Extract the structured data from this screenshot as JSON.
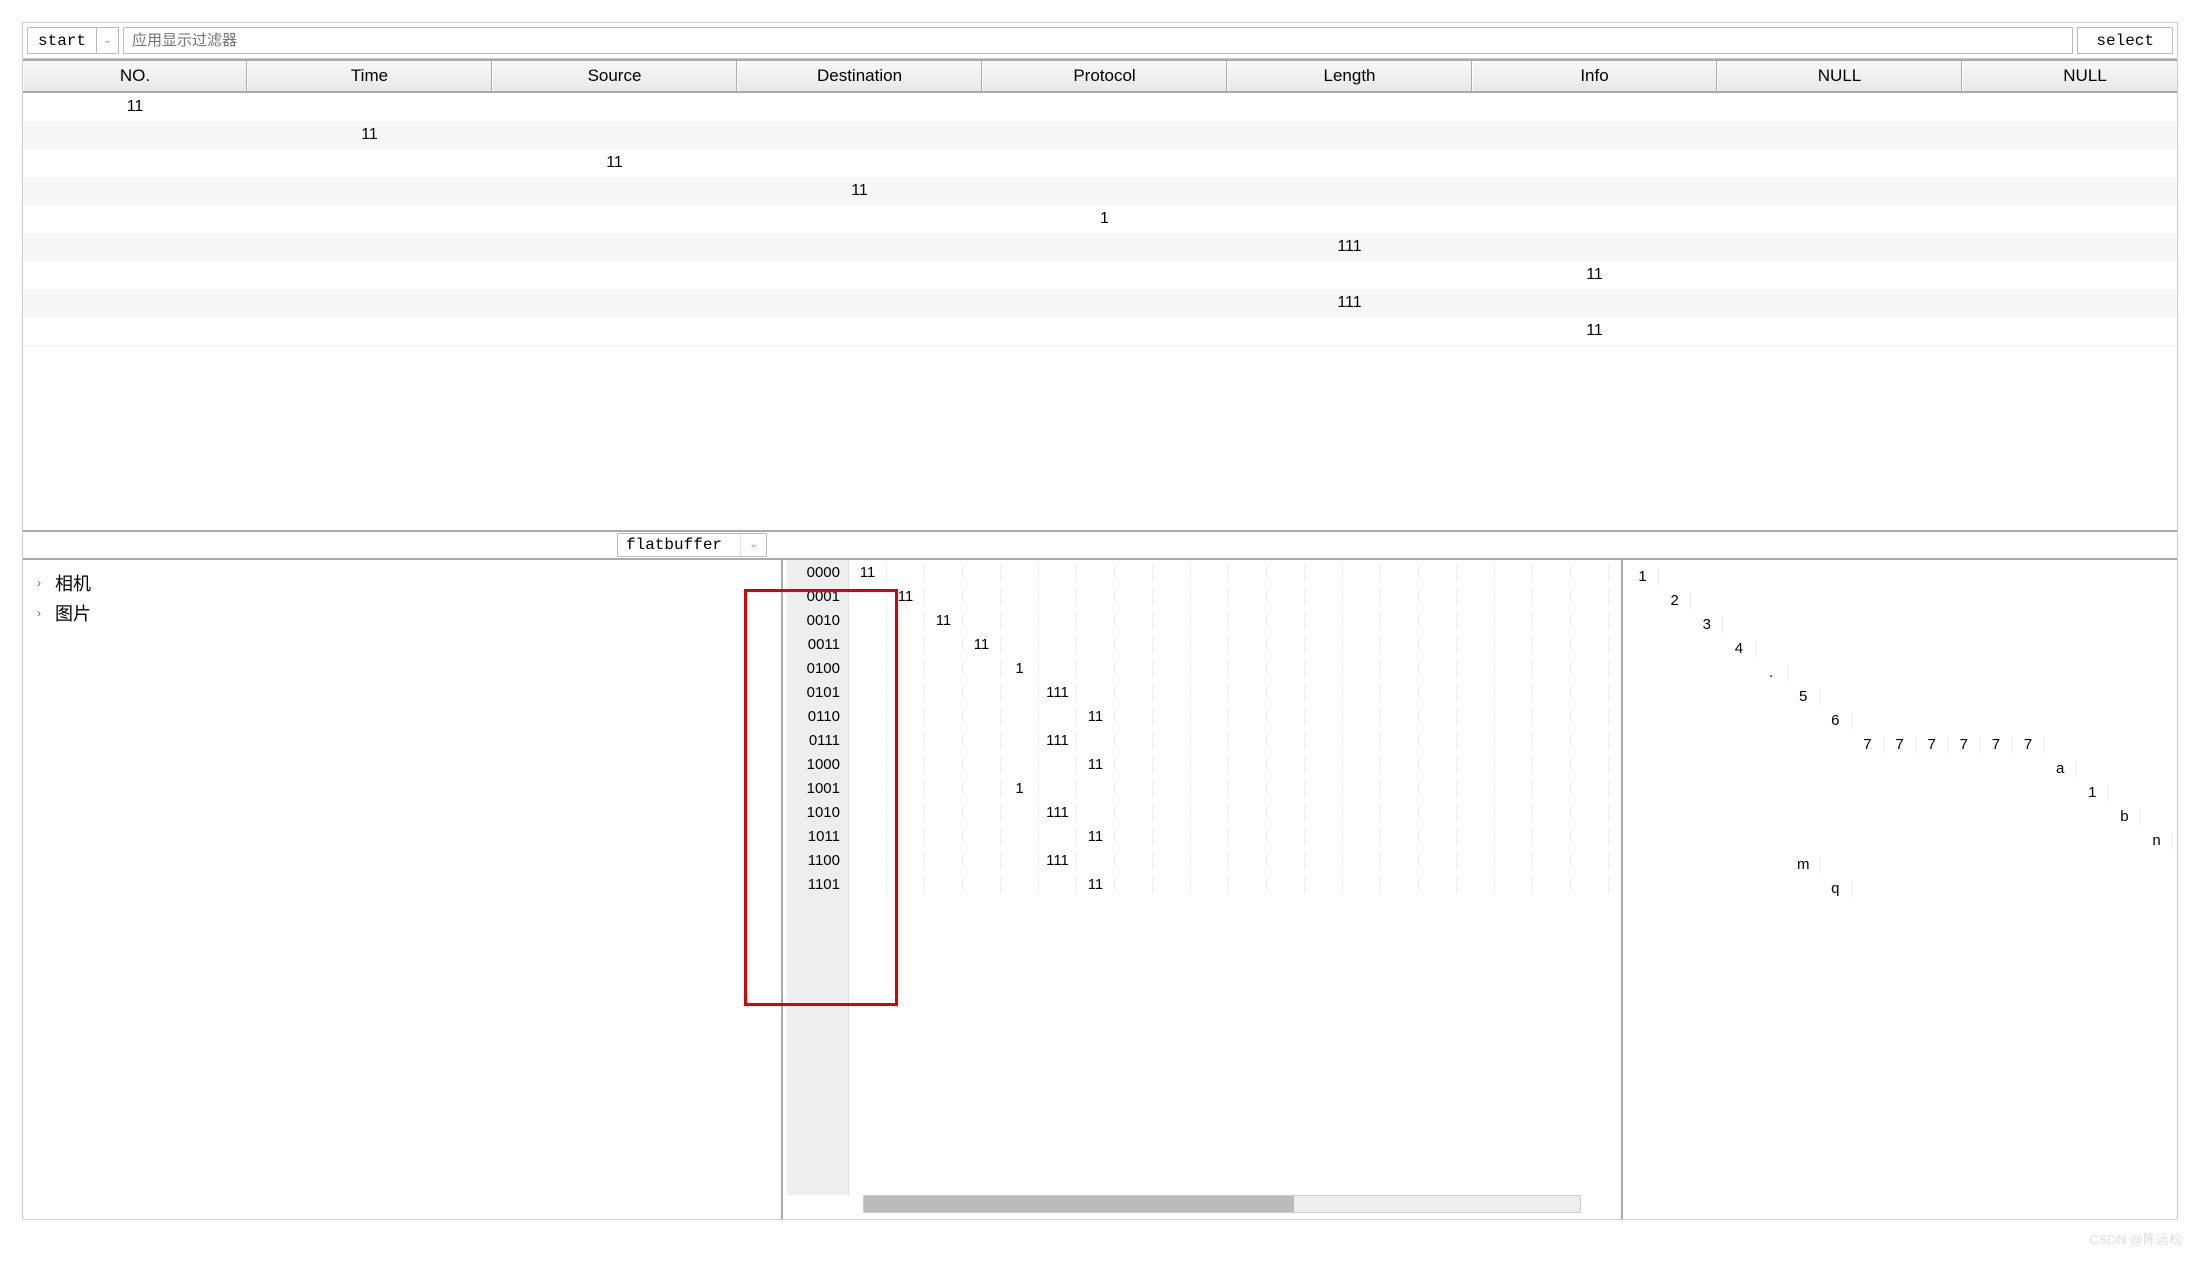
{
  "toolbar": {
    "start_label": "start",
    "filter_placeholder": "应用显示过滤器",
    "select_label": "select"
  },
  "grid": {
    "headers": [
      "NO.",
      "Time",
      "Source",
      "Destination",
      "Protocol",
      "Length",
      "Info",
      "NULL",
      "NULL"
    ],
    "rows": [
      [
        "11",
        "",
        "",
        "",
        "",
        "",
        "",
        "",
        ""
      ],
      [
        "",
        "11",
        "",
        "",
        "",
        "",
        "",
        "",
        ""
      ],
      [
        "",
        "",
        "11",
        "",
        "",
        "",
        "",
        "",
        ""
      ],
      [
        "",
        "",
        "",
        "11",
        "",
        "",
        "",
        "",
        ""
      ],
      [
        "",
        "",
        "",
        "",
        "1",
        "",
        "",
        "",
        ""
      ],
      [
        "",
        "",
        "",
        "",
        "",
        "111",
        "",
        "",
        ""
      ],
      [
        "",
        "",
        "",
        "",
        "",
        "",
        "11",
        "",
        ""
      ],
      [
        "",
        "",
        "",
        "",
        "",
        "111",
        "",
        "",
        ""
      ],
      [
        "",
        "",
        "",
        "",
        "",
        "",
        "11",
        "",
        ""
      ]
    ]
  },
  "flatbuffer_label": "flatbuffer",
  "tree": {
    "items": [
      "相机",
      "图片"
    ]
  },
  "hex": {
    "offsets": [
      "0000",
      "0001",
      "0010",
      "0011",
      "0100",
      "0101",
      "0110",
      "0111",
      "1000",
      "1001",
      "1010",
      "1011",
      "1100",
      "1101"
    ],
    "rows": [
      {
        "col": 0,
        "val": "11"
      },
      {
        "col": 1,
        "val": "11"
      },
      {
        "col": 2,
        "val": "11"
      },
      {
        "col": 3,
        "val": "11"
      },
      {
        "col": 4,
        "val": "1"
      },
      {
        "col": 5,
        "val": "111"
      },
      {
        "col": 6,
        "val": "11"
      },
      {
        "col": 5,
        "val": "111"
      },
      {
        "col": 6,
        "val": "11"
      },
      {
        "col": 4,
        "val": "1"
      },
      {
        "col": 5,
        "val": "111"
      },
      {
        "col": 6,
        "val": "11"
      },
      {
        "col": 5,
        "val": "111"
      },
      {
        "col": 6,
        "val": "11"
      }
    ]
  },
  "ascii": {
    "rows": [
      [
        {
          "c": 0,
          "v": "1"
        }
      ],
      [
        {
          "c": 1,
          "v": "2"
        }
      ],
      [
        {
          "c": 2,
          "v": "3"
        }
      ],
      [
        {
          "c": 3,
          "v": "4"
        }
      ],
      [
        {
          "c": 4,
          "v": "."
        }
      ],
      [
        {
          "c": 5,
          "v": "5"
        }
      ],
      [
        {
          "c": 6,
          "v": "6"
        }
      ],
      [
        {
          "c": 7,
          "v": "7"
        },
        {
          "c": 8,
          "v": "7"
        },
        {
          "c": 9,
          "v": "7"
        },
        {
          "c": 10,
          "v": "7"
        },
        {
          "c": 11,
          "v": "7"
        },
        {
          "c": 12,
          "v": "7"
        }
      ],
      [
        {
          "c": 13,
          "v": "a"
        }
      ],
      [
        {
          "c": 14,
          "v": "1"
        }
      ],
      [
        {
          "c": 15,
          "v": "b"
        }
      ],
      [
        {
          "c": 16,
          "v": "n"
        }
      ],
      [
        {
          "c": 5,
          "v": "m"
        }
      ],
      [
        {
          "c": 6,
          "v": "q"
        }
      ]
    ]
  },
  "watermark": "CSDN @陈远松"
}
